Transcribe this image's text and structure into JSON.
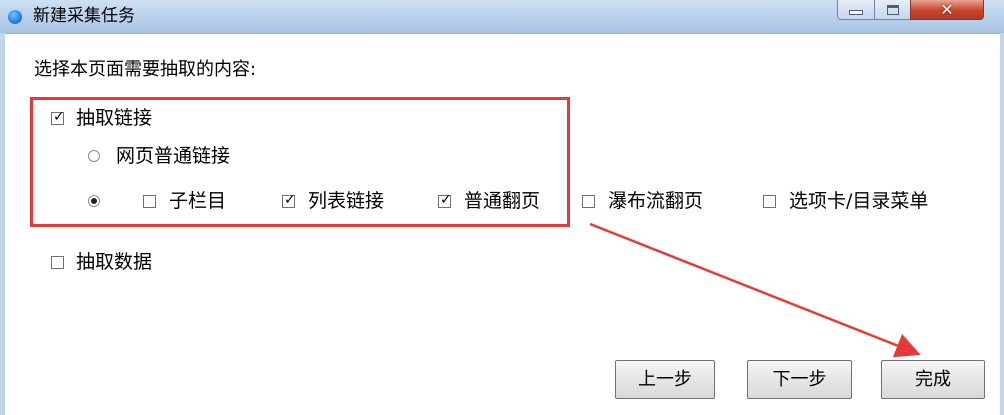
{
  "window": {
    "title": "新建采集任务",
    "close_glyph": "✕"
  },
  "main": {
    "prompt": "选择本页面需要抽取的内容:"
  },
  "extract_links": {
    "label": "抽取链接",
    "checked": true
  },
  "link_types": {
    "normal_links": {
      "label": "网页普通链接",
      "selected": false
    },
    "category_links": {
      "selected": true
    }
  },
  "sub_options": [
    {
      "label": "子栏目",
      "checked": false
    },
    {
      "label": "列表链接",
      "checked": true
    },
    {
      "label": "普通翻页",
      "checked": true
    },
    {
      "label": "瀑布流翻页",
      "checked": false
    },
    {
      "label": "选项卡/目录菜单",
      "checked": false
    }
  ],
  "extract_data": {
    "label": "抽取数据",
    "checked": false
  },
  "buttons": {
    "prev": "上一步",
    "next": "下一步",
    "finish": "完成"
  },
  "colors": {
    "annotation_red": "#e5393a"
  },
  "checkmark": "✓"
}
